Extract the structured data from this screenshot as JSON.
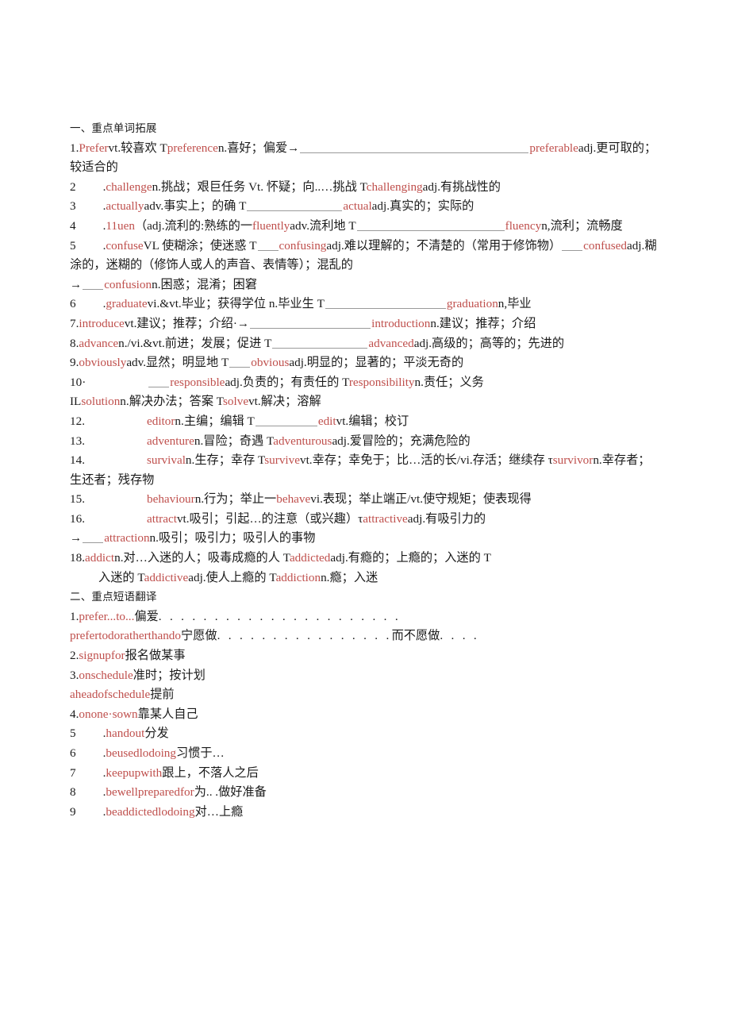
{
  "document": {
    "sections": [
      {
        "heading": "一、重点单词拓展",
        "entries": [
          {
            "num": "1.",
            "parts": "Prefer|vt.较喜欢 T|preference|n.喜好；偏爱→ ____ |preferable|adj.更可取的；较适合的"
          }
        ]
      }
    ]
  },
  "headings": {
    "section1": "一、重点单词拓展",
    "section2": "二、重点短语翻译"
  },
  "words": {
    "item1": {
      "num": "1.",
      "w1": "Prefer",
      "t1": "vt.较喜欢 T",
      "w2": "preference",
      "t2": "n.喜好；偏爱→",
      "w3": "preferable",
      "t3": "adj.更可取的；较适合的"
    },
    "item2": {
      "num": "2",
      "lead": ".",
      "w1": "challenge",
      "t1": "n.挑战；艰巨任务 Vt. 怀疑；向..…挑战 T",
      "w2": "challenging",
      "t2": "adj.有挑战性的"
    },
    "item3": {
      "num": "3",
      "lead": ".",
      "w1": "actually",
      "t1": "adv.事实上；的确 T",
      "w2": "actual",
      "t2": "adj.真实的；实际的"
    },
    "item4": {
      "num": "4",
      "lead": ".",
      "w1": "11uen",
      "t1": "（adj.流利的:熟练的一",
      "w2": "fluently",
      "t2": "adv.流利地 T",
      "w3": "fluency",
      "t3": "n,流利；流畅度"
    },
    "item5": {
      "num": "5",
      "lead": ".",
      "w1": "confuse",
      "t1": "VL 使糊涂；使迷惑 T",
      "w2": "confusing",
      "t2": "adj.难以理解的；不清楚的（常用于修饰物）",
      "w3": "confused",
      "t3": "adj.糊涂的，迷糊的（修饰人或人的声音、表情等）；混乱的",
      "arrow": "→",
      "w4": "confusion",
      "t4": "n.困惑；混淆；困窘"
    },
    "item6": {
      "num": "6",
      "lead": ".",
      "w1": "graduate",
      "t1": "vi.&vt.毕业；获得学位 n.毕业生 T",
      "w2": "graduation",
      "t2": "n,毕业"
    },
    "item7": {
      "num": "7.",
      "w1": "introduce",
      "t1": "vt.建议；推荐；介绍·→",
      "w2": "introduction",
      "t2": "n.建议；推荐；介绍"
    },
    "item8": {
      "num": "8.",
      "w1": "advance",
      "t1": "n./vi.&vt.前进；发展；促进 T",
      "w2": "advanced",
      "t2": "adj.高级的；高等的；先进的"
    },
    "item9": {
      "num": "9.",
      "w1": "obviously",
      "t1": "adv.显然；明显地 T",
      "w2": "obvious",
      "t2": "adj.明显的；显著的；平淡无奇的"
    },
    "item10": {
      "num": "10·",
      "w1": "responsible",
      "t1": "adj.负责的；有责任的 T",
      "w2": "responsibility",
      "t2": "n.责任；义务"
    },
    "item11": {
      "num": "IL",
      "w1": "solution",
      "t1": "n.解决办法；答案 T",
      "w2": "solve",
      "t2": "vt.解决；溶解"
    },
    "item12": {
      "num": "12.",
      "w1": "editor",
      "t1": "n.主编；编辑 T",
      "w2": "edit",
      "t2": "vt.编辑；校订"
    },
    "item13": {
      "num": "13.",
      "w1": "adventure",
      "t1": "n.冒险；奇遇 T",
      "w2": "adventurous",
      "t2": "adj.爱冒险的；充满危险的"
    },
    "item14": {
      "num": "14.",
      "w1": "survival",
      "t1": "n.生存；幸存 T",
      "w2": "survive",
      "t2": "vt.幸存；幸免于；比…活的长/vi.存活；继续存 τ",
      "w3": "survivor",
      "t3": "n.幸存者；生还者；残存物"
    },
    "item15": {
      "num": "15.",
      "w1": "behaviour",
      "t1": "n.行为；举止一",
      "w2": "behave",
      "t2": "vi.表现；举止端正/vt.使守规矩；使表现得"
    },
    "item16": {
      "num": "16.",
      "w1": "attract",
      "t1": "vt.吸引；引起…的注意（或兴趣）τ",
      "w2": "attractive",
      "t2": "adj.有吸引力的",
      "arrow": "→",
      "w3": "attraction",
      "t3": "n.吸引；吸引力；吸引人的事物"
    },
    "item18": {
      "num": "18.",
      "w1": "addict",
      "t1": "n.对…入迷的人；吸毒成瘾的人 T",
      "w2": "addicted",
      "t2": "adj.有瘾的；上瘾的；入迷的 T",
      "w3": "addictive",
      "t3": "adj.使人上瘾的 T",
      "w4": "addiction",
      "t4": "n.瘾；入迷"
    }
  },
  "phrases": {
    "item1": {
      "num": "1.",
      "en": "prefer...to...",
      "cn": "偏爱",
      "leader": ". . . . . . . . . . . . . . . . . . . . . ."
    },
    "item1b": {
      "en": "prefertodoratherthando",
      "cn": "宁愿做",
      "leader": ". . . . . . . . . . . . . . . .",
      "cn2": "而不愿做",
      "leader2": ". . . ."
    },
    "item2": {
      "num": "2.",
      "en": "signupfor",
      "cn": "报名做某事"
    },
    "item3": {
      "num": "3.",
      "en": "onschedule",
      "cn": "准时；按计划"
    },
    "item3b": {
      "en": "aheadofschedule",
      "cn": "提前"
    },
    "item4": {
      "num": "4.",
      "en": "onone·sown",
      "cn": "靠某人自己"
    },
    "item5": {
      "num": "5",
      "lead": ".",
      "en": "handout",
      "cn": "分发"
    },
    "item6": {
      "num": "6",
      "lead": ".",
      "en": "beusedlodoing",
      "cn": "习惯于…"
    },
    "item7": {
      "num": "7",
      "lead": ".",
      "en": "keepupwith",
      "cn": "跟上，不落人之后"
    },
    "item8": {
      "num": "8",
      "lead": ".",
      "en": "bewellpreparedfor",
      "cn": "为.. .做好准备"
    },
    "item9": {
      "num": "9",
      "lead": ".",
      "en": "beaddictedlodoing",
      "cn": "对…上瘾"
    }
  },
  "colors": {
    "english_red": "#bf4f4c",
    "text_black": "#1a1a1a",
    "blank_gray": "#9a9a9a"
  }
}
